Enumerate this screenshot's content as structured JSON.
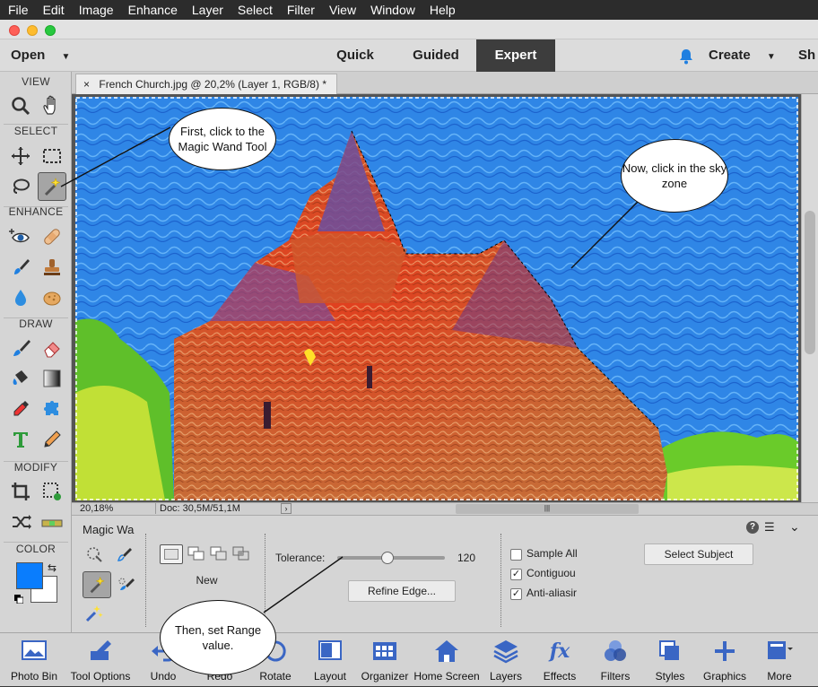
{
  "menubar": {
    "items": [
      "File",
      "Edit",
      "Image",
      "Enhance",
      "Layer",
      "Select",
      "Filter",
      "View",
      "Window",
      "Help"
    ]
  },
  "modebar": {
    "open_label": "Open",
    "quick": "Quick",
    "guided": "Guided",
    "expert": "Expert",
    "create": "Create",
    "share": "Sh"
  },
  "toolbox": {
    "view": "VIEW",
    "select": "SELECT",
    "enhance": "ENHANCE",
    "draw": "DRAW",
    "modify": "MODIFY",
    "color": "COLOR"
  },
  "document": {
    "tab_title": "French Church.jpg @ 20,2% (Layer 1, RGB/8) *"
  },
  "status": {
    "zoom": "20,18%",
    "doc": "Doc: 30,5M/51,1M"
  },
  "tool_options": {
    "tool_name": "Magic Wa",
    "new_label": "New",
    "tolerance_label": "Tolerance:",
    "tolerance_value": "120",
    "tolerance_fraction": 0.47,
    "refine_edge": "Refine Edge...",
    "sample_all": "Sample All",
    "contiguous": "Contiguou",
    "anti_alias": "Anti-aliasir",
    "select_subject": "Select Subject"
  },
  "taskbar": {
    "items": [
      "Photo Bin",
      "Tool Options",
      "Undo",
      "Redo",
      "Rotate",
      "Layout",
      "Organizer",
      "Home Screen",
      "Layers",
      "Effects",
      "Filters",
      "Styles",
      "Graphics",
      "More"
    ]
  },
  "callouts": {
    "wand": "First, click to the Magic Wand Tool",
    "sky": "Now, click in the sky zone",
    "range": "Then, set Range value."
  },
  "colors": {
    "foreground": "#0a7dfd",
    "background": "#ffffff",
    "accent": "#1f7fe0"
  }
}
